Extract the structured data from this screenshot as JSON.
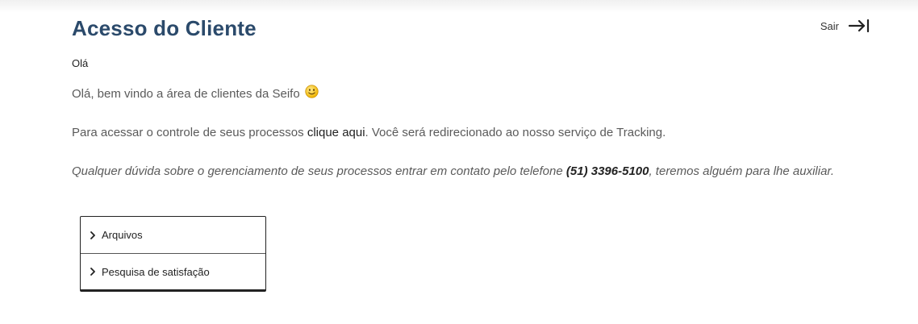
{
  "header": {
    "title": "Acesso do Cliente",
    "logout_label": "Sair",
    "logout_icon": "logout-arrow-icon"
  },
  "content": {
    "greeting": "Olá",
    "welcome_text": "Olá, bem vindo a área de clientes da Seifo",
    "welcome_icon": "smiley-icon",
    "access_prefix": "Para acessar o controle de seus processos ",
    "access_link": "clique aqui",
    "access_suffix": ". Você será redirecionado ao nosso serviço de Tracking.",
    "contact_prefix": "Qualquer dúvida sobre o gerenciamento de seus processos entrar em contato pelo telefone ",
    "contact_phone": "(51) 3396-5100",
    "contact_suffix": ", teremos alguém para lhe auxiliar."
  },
  "panel": {
    "items": [
      {
        "label": "Arquivos",
        "icon": "chevron-right-icon"
      },
      {
        "label": "Pesquisa de satisfação",
        "icon": "chevron-right-icon"
      }
    ]
  },
  "colors": {
    "title": "#2b4a6b",
    "body_text": "#5a5a5a",
    "dark_text": "#222222"
  }
}
